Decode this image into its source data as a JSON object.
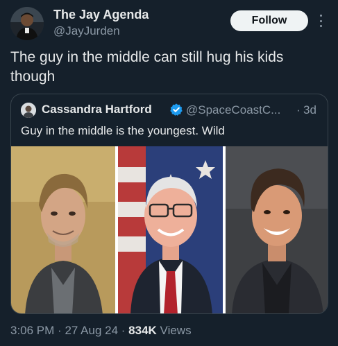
{
  "author": {
    "name": "The Jay Agenda",
    "handle": "@JayJurden",
    "avatar_icon": "profile-photo"
  },
  "follow_label": "Follow",
  "tweet_text": "The guy in the middle can still hug his kids though",
  "quote": {
    "name": "Cassandra Hartford",
    "handle": "@SpaceCoastC...",
    "separator": "·",
    "time": "3d",
    "text": "Guy in the middle is the youngest. Wild",
    "verified_color": "#1d9bf0",
    "media_icon": "three-portrait-photo-collage"
  },
  "footer": {
    "time": "3:06 PM",
    "date": "27 Aug 24",
    "separator": "·",
    "views_count": "834K",
    "views_label": "Views"
  },
  "colors": {
    "background": "#15202b",
    "primary_text": "#e7e9ea",
    "secondary_text": "#8b98a5",
    "border": "#38444d",
    "follow_button_bg": "#eff3f4"
  }
}
